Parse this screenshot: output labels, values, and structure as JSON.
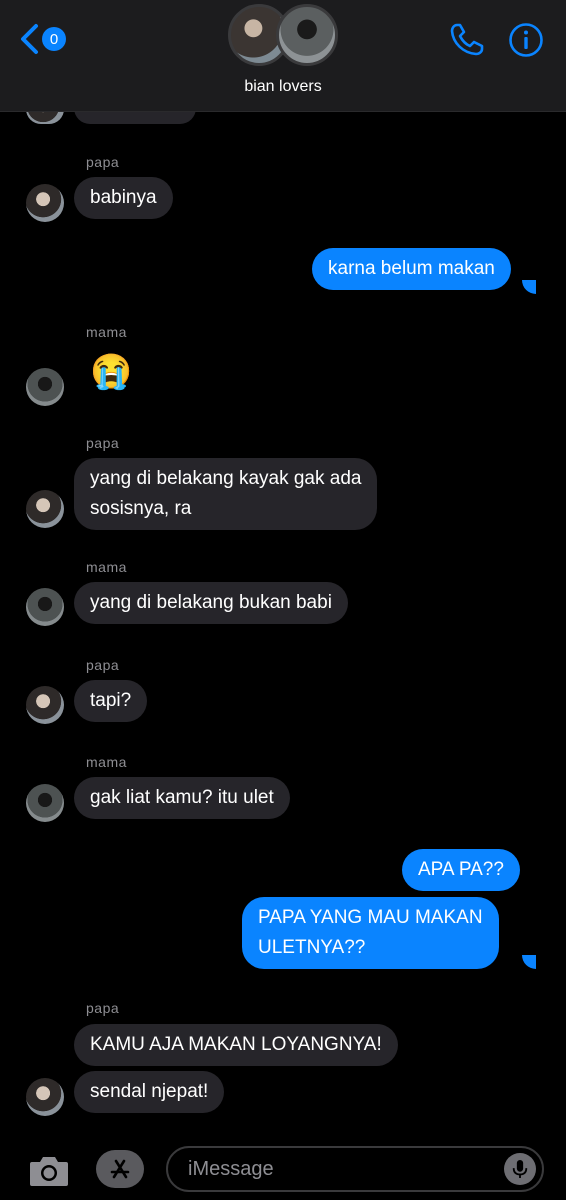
{
  "header": {
    "back_badge": "0",
    "group_name": "bian lovers"
  },
  "messages": [
    {
      "sender": "papa",
      "text": "babinya"
    },
    {
      "text": "karna belum makan"
    },
    {
      "sender": "mama",
      "text": "😭"
    },
    {
      "sender": "papa",
      "text": "yang di belakang kayak gak ada\nsosisnya, ra"
    },
    {
      "sender": "mama",
      "text": "yang di belakang bukan babi"
    },
    {
      "sender": "papa",
      "text": "tapi?"
    },
    {
      "sender": "mama",
      "text": "gak liat kamu? itu ulet"
    },
    {
      "text": "APA PA??"
    },
    {
      "text": "PAPA YANG MAU MAKAN\nULETNYA??"
    },
    {
      "sender": "papa",
      "text": "KAMU AJA MAKAN LOYANGNYA!"
    },
    {
      "text": "sendal njepat!"
    }
  ],
  "composer": {
    "placeholder": "iMessage"
  },
  "colors": {
    "accent": "#0a84ff",
    "incoming_bubble": "#26252a",
    "header_bg": "#1c1c1e"
  }
}
